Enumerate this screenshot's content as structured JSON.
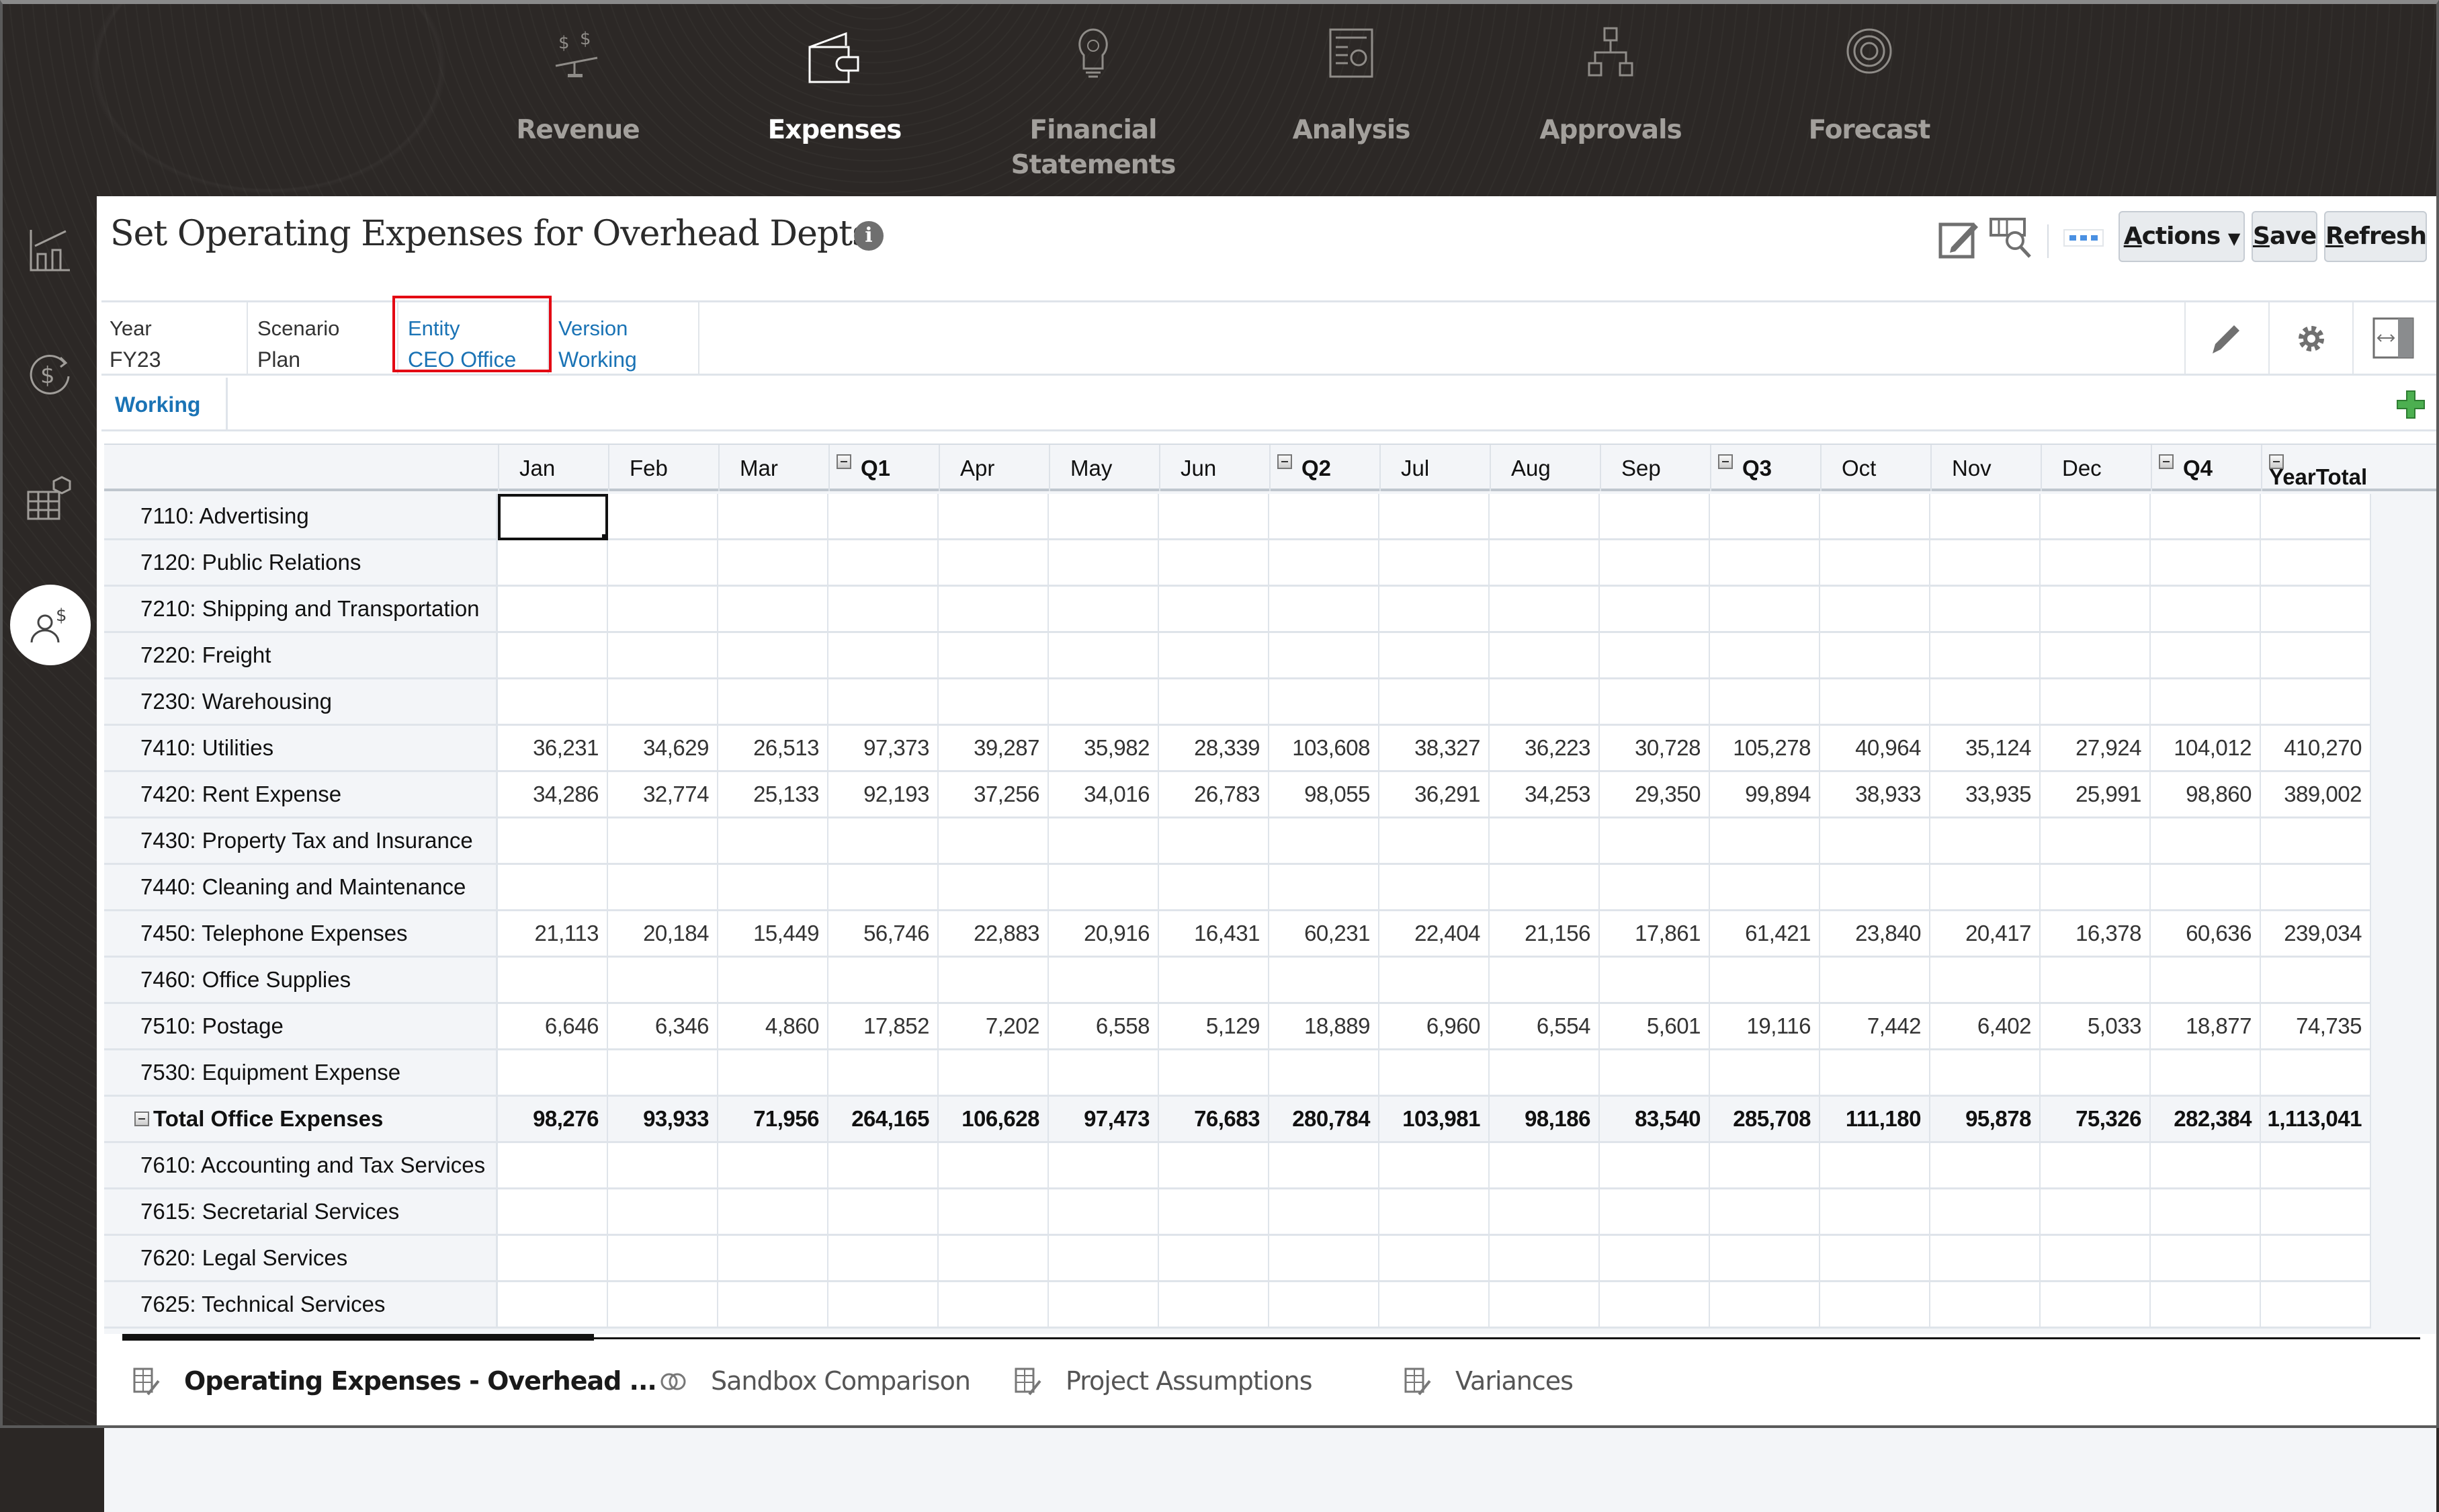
{
  "top_nav": {
    "items": [
      {
        "label": "Revenue",
        "icon": "balance-scale-dollar-icon",
        "active": false
      },
      {
        "label": "Expenses",
        "icon": "wallet-icon",
        "active": true
      },
      {
        "label": "Financial Statements",
        "label_line1": "Financial",
        "label_line2": "Statements",
        "icon": "lightbulb-icon",
        "active": false
      },
      {
        "label": "Analysis",
        "icon": "report-chart-icon",
        "active": false
      },
      {
        "label": "Approvals",
        "icon": "hierarchy-icon",
        "active": false
      },
      {
        "label": "Forecast",
        "icon": "target-icon",
        "active": false
      }
    ]
  },
  "sidebar": {
    "items": [
      {
        "icon": "chart-trend-icon",
        "active": false
      },
      {
        "icon": "dollar-cycle-icon",
        "active": false
      },
      {
        "icon": "grid-cube-icon",
        "active": false
      },
      {
        "icon": "user-dollar-icon",
        "active": true
      }
    ]
  },
  "header": {
    "title": "Set Operating Expenses for Overhead Depts",
    "info_icon": "i"
  },
  "toolbar": {
    "actions_label": "Actions",
    "actions_accel": "A",
    "actions_rest": "ctions",
    "save_label": "Save",
    "save_accel": "S",
    "save_rest": "ave",
    "refresh_label": "Refresh",
    "refresh_accel": "R",
    "refresh_rest": "efresh"
  },
  "pov": {
    "items": [
      {
        "key": "Year",
        "value": "FY23",
        "link": false
      },
      {
        "key": "Scenario",
        "value": "Plan",
        "link": false
      },
      {
        "key": "Entity",
        "value": "CEO Office",
        "link": true,
        "highlighted": true
      },
      {
        "key": "Version",
        "value": "Working",
        "link": true
      }
    ]
  },
  "working_tab": {
    "label": "Working"
  },
  "grid": {
    "columns": [
      {
        "label": "Jan",
        "collapsible": false
      },
      {
        "label": "Feb",
        "collapsible": false
      },
      {
        "label": "Mar",
        "collapsible": false
      },
      {
        "label": "Q1",
        "collapsible": true
      },
      {
        "label": "Apr",
        "collapsible": false
      },
      {
        "label": "May",
        "collapsible": false
      },
      {
        "label": "Jun",
        "collapsible": false
      },
      {
        "label": "Q2",
        "collapsible": true
      },
      {
        "label": "Jul",
        "collapsible": false
      },
      {
        "label": "Aug",
        "collapsible": false
      },
      {
        "label": "Sep",
        "collapsible": false
      },
      {
        "label": "Q3",
        "collapsible": true
      },
      {
        "label": "Oct",
        "collapsible": false
      },
      {
        "label": "Nov",
        "collapsible": false
      },
      {
        "label": "Dec",
        "collapsible": false
      },
      {
        "label": "Q4",
        "collapsible": true
      },
      {
        "label": "YearTotal",
        "collapsible": true
      }
    ],
    "rows": [
      {
        "label": "7110: Advertising",
        "values": [
          "",
          "",
          "",
          "",
          "",
          "",
          "",
          "",
          "",
          "",
          "",
          "",
          "",
          "",
          "",
          "",
          ""
        ]
      },
      {
        "label": "7120: Public Relations",
        "values": [
          "",
          "",
          "",
          "",
          "",
          "",
          "",
          "",
          "",
          "",
          "",
          "",
          "",
          "",
          "",
          "",
          ""
        ]
      },
      {
        "label": "7210: Shipping and Transportation",
        "values": [
          "",
          "",
          "",
          "",
          "",
          "",
          "",
          "",
          "",
          "",
          "",
          "",
          "",
          "",
          "",
          "",
          ""
        ]
      },
      {
        "label": "7220: Freight",
        "values": [
          "",
          "",
          "",
          "",
          "",
          "",
          "",
          "",
          "",
          "",
          "",
          "",
          "",
          "",
          "",
          "",
          ""
        ]
      },
      {
        "label": "7230: Warehousing",
        "values": [
          "",
          "",
          "",
          "",
          "",
          "",
          "",
          "",
          "",
          "",
          "",
          "",
          "",
          "",
          "",
          "",
          ""
        ]
      },
      {
        "label": "7410: Utilities",
        "values": [
          "36,231",
          "34,629",
          "26,513",
          "97,373",
          "39,287",
          "35,982",
          "28,339",
          "103,608",
          "38,327",
          "36,223",
          "30,728",
          "105,278",
          "40,964",
          "35,124",
          "27,924",
          "104,012",
          "410,270"
        ]
      },
      {
        "label": "7420: Rent Expense",
        "values": [
          "34,286",
          "32,774",
          "25,133",
          "92,193",
          "37,256",
          "34,016",
          "26,783",
          "98,055",
          "36,291",
          "34,253",
          "29,350",
          "99,894",
          "38,933",
          "33,935",
          "25,991",
          "98,860",
          "389,002"
        ]
      },
      {
        "label": "7430: Property Tax and Insurance",
        "values": [
          "",
          "",
          "",
          "",
          "",
          "",
          "",
          "",
          "",
          "",
          "",
          "",
          "",
          "",
          "",
          "",
          ""
        ]
      },
      {
        "label": "7440: Cleaning and Maintenance",
        "values": [
          "",
          "",
          "",
          "",
          "",
          "",
          "",
          "",
          "",
          "",
          "",
          "",
          "",
          "",
          "",
          "",
          ""
        ]
      },
      {
        "label": "7450: Telephone Expenses",
        "values": [
          "21,113",
          "20,184",
          "15,449",
          "56,746",
          "22,883",
          "20,916",
          "16,431",
          "60,231",
          "22,404",
          "21,156",
          "17,861",
          "61,421",
          "23,840",
          "20,417",
          "16,378",
          "60,636",
          "239,034"
        ]
      },
      {
        "label": "7460: Office Supplies",
        "values": [
          "",
          "",
          "",
          "",
          "",
          "",
          "",
          "",
          "",
          "",
          "",
          "",
          "",
          "",
          "",
          "",
          ""
        ]
      },
      {
        "label": "7510: Postage",
        "values": [
          "6,646",
          "6,346",
          "4,860",
          "17,852",
          "7,202",
          "6,558",
          "5,129",
          "18,889",
          "6,960",
          "6,554",
          "5,601",
          "19,116",
          "7,442",
          "6,402",
          "5,033",
          "18,877",
          "74,735"
        ]
      },
      {
        "label": "7530: Equipment Expense",
        "values": [
          "",
          "",
          "",
          "",
          "",
          "",
          "",
          "",
          "",
          "",
          "",
          "",
          "",
          "",
          "",
          "",
          ""
        ]
      },
      {
        "label": "Total Office Expenses",
        "total": true,
        "collapsible": true,
        "values": [
          "98,276",
          "93,933",
          "71,956",
          "264,165",
          "106,628",
          "97,473",
          "76,683",
          "280,784",
          "103,981",
          "98,186",
          "83,540",
          "285,708",
          "111,180",
          "95,878",
          "75,326",
          "282,384",
          "1,113,041"
        ]
      },
      {
        "label": "7610: Accounting and Tax Services",
        "values": [
          "",
          "",
          "",
          "",
          "",
          "",
          "",
          "",
          "",
          "",
          "",
          "",
          "",
          "",
          "",
          "",
          ""
        ]
      },
      {
        "label": "7615: Secretarial Services",
        "values": [
          "",
          "",
          "",
          "",
          "",
          "",
          "",
          "",
          "",
          "",
          "",
          "",
          "",
          "",
          "",
          "",
          ""
        ]
      },
      {
        "label": "7620: Legal Services",
        "values": [
          "",
          "",
          "",
          "",
          "",
          "",
          "",
          "",
          "",
          "",
          "",
          "",
          "",
          "",
          "",
          "",
          ""
        ]
      },
      {
        "label": "7625: Technical Services",
        "values": [
          "",
          "",
          "",
          "",
          "",
          "",
          "",
          "",
          "",
          "",
          "",
          "",
          "",
          "",
          "",
          "",
          ""
        ]
      }
    ],
    "selected_cell": {
      "row": "7110: Advertising",
      "column": "Jan"
    }
  },
  "bottom_tabs": [
    {
      "label": "Operating Expenses - Overhead ...",
      "icon": "form-grid-icon",
      "active": true
    },
    {
      "label": "Sandbox Comparison",
      "icon": "sandbox-icon",
      "active": false
    },
    {
      "label": "Project Assumptions",
      "icon": "form-grid-icon",
      "active": false
    },
    {
      "label": "Variances",
      "icon": "form-grid-icon",
      "active": false
    }
  ],
  "colors": {
    "nav_bg": "#2b2725",
    "link_blue": "#1a73b5",
    "highlight_red": "#e30613",
    "add_green": "#3aa53a",
    "grid_header_bg": "#f3f5f8"
  }
}
